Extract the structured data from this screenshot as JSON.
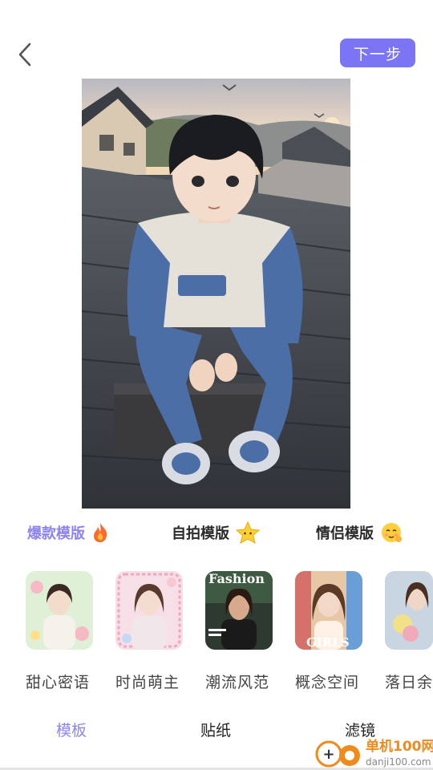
{
  "header": {
    "back_icon": "chevron-left-icon",
    "next_label": "下一步",
    "accent_color": "#7b75f6"
  },
  "categories": [
    {
      "label": "爆款模版",
      "icon": "fire-icon",
      "active": true
    },
    {
      "label": "自拍模版",
      "icon": "star-icon",
      "active": false
    },
    {
      "label": "情侣模版",
      "icon": "smiling-face-icon",
      "active": false
    }
  ],
  "templates": [
    {
      "name": "甜心密语"
    },
    {
      "name": "时尚萌主"
    },
    {
      "name": "潮流风范",
      "thumb_text": "Fashion"
    },
    {
      "name": "概念空间",
      "thumb_text": "GIRLS"
    },
    {
      "name": "落日余"
    }
  ],
  "bottom_tabs": [
    {
      "label": "模板",
      "active": true
    },
    {
      "label": "贴纸",
      "active": false
    },
    {
      "label": "滤镜",
      "active": false
    }
  ],
  "watermark": {
    "name": "单机100网",
    "url": "danji100.com"
  }
}
